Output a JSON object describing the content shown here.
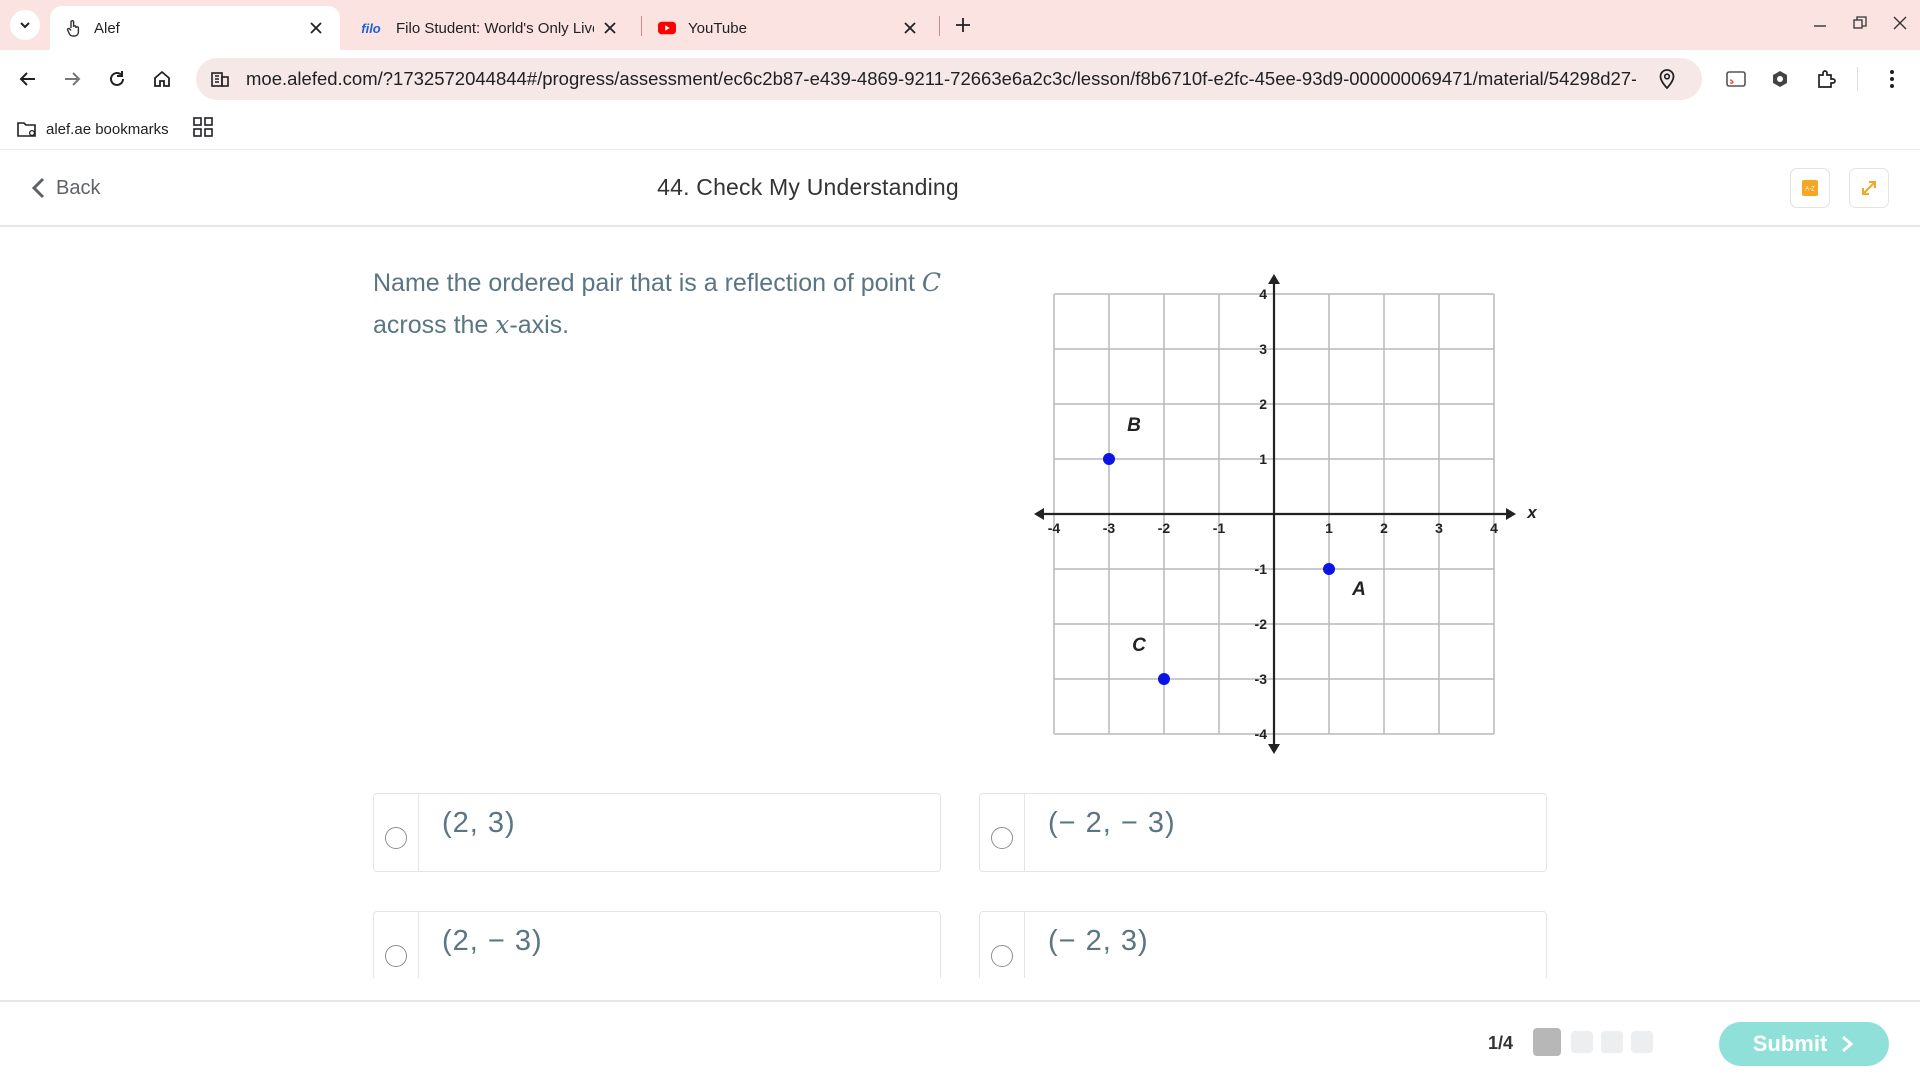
{
  "browser": {
    "tabs": [
      {
        "title": "Alef",
        "favicon": "hand-pointer-icon",
        "active": true
      },
      {
        "title": "Filo Student: World's Only Live I",
        "favicon_text": "filo",
        "active": false
      },
      {
        "title": "YouTube",
        "favicon": "youtube-icon",
        "active": false
      }
    ],
    "url": "moe.alefed.com/?1732572044844#/progress/assessment/ec6c2b87-e439-4869-9211-72663e6a2c3c/lesson/f8b6710f-e2fc-45ee-93d9-000000069471/material/54298d27-2c91...",
    "bookmark": "alef.ae bookmarks"
  },
  "header": {
    "back_label": "Back",
    "title": "44. Check My Understanding"
  },
  "question": {
    "part1": "Name the ordered pair that is a reflection of point ",
    "point": "C",
    "part2": "across the ",
    "axis": "x",
    "part3": "-axis."
  },
  "chart_data": {
    "type": "scatter",
    "xlim": [
      -4,
      4
    ],
    "ylim": [
      -4,
      4
    ],
    "grid": true,
    "xlabel": "x",
    "x_ticks": [
      "-4",
      "-3",
      "-2",
      "-1",
      "1",
      "2",
      "3",
      "4"
    ],
    "y_ticks": [
      "4",
      "3",
      "2",
      "1",
      "-1",
      "-2",
      "-3",
      "-4"
    ],
    "points": [
      {
        "label": "B",
        "x": -3,
        "y": 1
      },
      {
        "label": "A",
        "x": 1,
        "y": -1
      },
      {
        "label": "C",
        "x": -2,
        "y": -3
      }
    ],
    "point_color": "#0a14e6"
  },
  "options": [
    {
      "label": "(2, 3)"
    },
    {
      "label": "(− 2, − 3)"
    },
    {
      "label": "(2, − 3)"
    },
    {
      "label": "(− 2, 3)"
    }
  ],
  "footer": {
    "progress": "1/4",
    "total_steps": 4,
    "current_step": 1,
    "submit_label": "Submit"
  },
  "colors": {
    "accent_orange": "#f5a623",
    "submit": "#8fe0d8",
    "text_question": "#5a7583"
  }
}
